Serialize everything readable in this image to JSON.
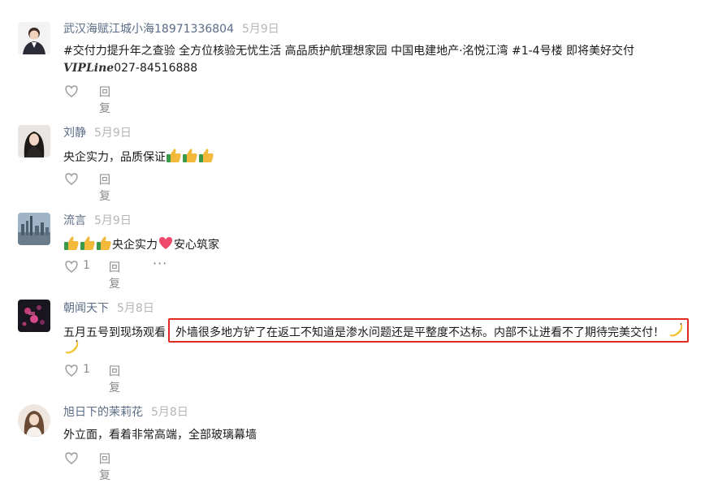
{
  "comments": [
    {
      "name": "武汉海赋江城小海18971336804",
      "date": "5月9日",
      "line1": "#交付力提升年之查验 全方位核验无忧生活 高品质护航理想家园 中国电建地产·洺悦江湾 #1-4号楼 即将美好交付",
      "line2_vip": "VIPLine",
      "line2_phone": "027-84516888",
      "reply_label": "回复"
    },
    {
      "name": "刘静",
      "date": "5月9日",
      "text": "央企实力，品质保证",
      "reply_label": "回复"
    },
    {
      "name": "流言",
      "date": "5月9日",
      "text_a": "央企实力",
      "text_b": "安心筑家",
      "likes": "1",
      "reply_label": "回复",
      "more_label": "···"
    },
    {
      "name": "朝闻天下",
      "date": "5月8日",
      "text_before": "五月五号到现场观看",
      "text_highlight": "外墙很多地方铲了在返工不知道是渗水问题还是平整度不达标。内部不让进看不了期待完美交付！",
      "likes": "1",
      "reply_label": "回复"
    },
    {
      "name": "旭日下的茉莉花",
      "date": "5月8日",
      "text": "外立面，看着非常高端，全部玻璃幕墙",
      "reply_label": "回复"
    }
  ],
  "colors": {
    "name": "#5a6b86",
    "date": "#b5b5b5",
    "highlight_border": "#e02b20"
  }
}
